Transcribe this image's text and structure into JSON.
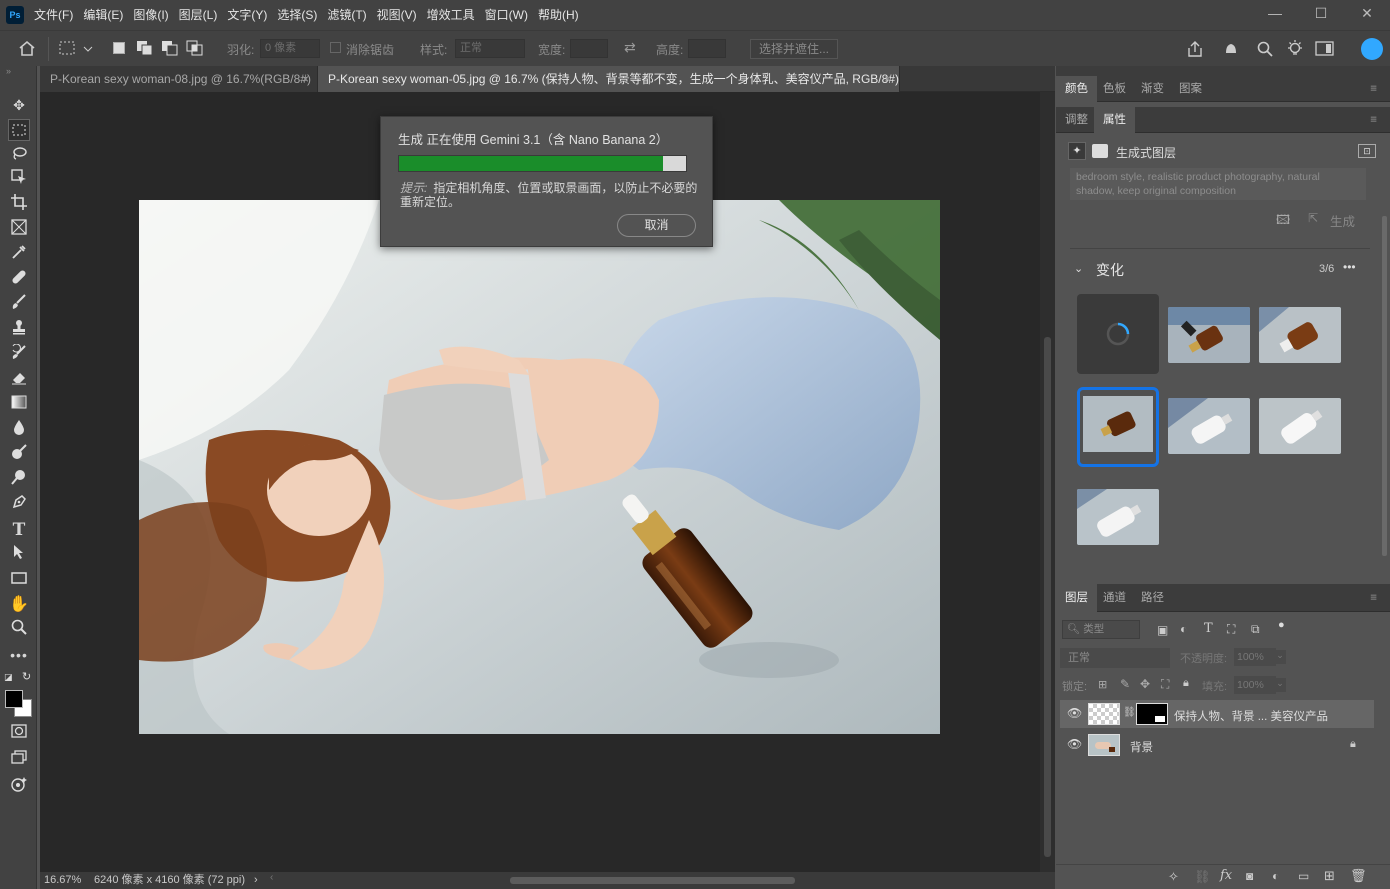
{
  "app": {
    "logo_text": "Ps"
  },
  "menu": [
    "文件(F)",
    "编辑(E)",
    "图像(I)",
    "图层(L)",
    "文字(Y)",
    "选择(S)",
    "滤镜(T)",
    "视图(V)",
    "增效工具",
    "窗口(W)",
    "帮助(H)"
  ],
  "options": {
    "feather_label": "羽化:",
    "feather_value": "0 像素",
    "antialias_label": "消除锯齿",
    "style_label": "样式:",
    "style_value": "正常",
    "width_label": "宽度:",
    "height_label": "高度:",
    "select_mask_button": "选择并遮住..."
  },
  "tabs": [
    {
      "label": "P-Korean sexy woman-08.jpg @ 16.7%(RGB/8#)",
      "close": "×",
      "active": false
    },
    {
      "label": "P-Korean sexy woman-05.jpg @ 16.7% (保持人物、背景等都不变，生成一个身体乳、美容仪产品, RGB/8#) *",
      "close": "×",
      "active": true
    }
  ],
  "dialog": {
    "title": "生成 正在使用 Gemini 3.1（含 Nano Banana 2）",
    "progress": 0.92,
    "tip_label": "提示:",
    "tip_text": "指定相机角度、位置或取景画面，以防止不必要的重新定位。",
    "cancel_label": "取消"
  },
  "status": {
    "zoom": "16.67%",
    "doc_size": "6240 像素 x 4160 像素 (72 ppi)",
    "arrow": "›"
  },
  "panel_top": {
    "tabs": [
      "颜色",
      "色板",
      "渐变",
      "图案"
    ],
    "active": "颜色"
  },
  "panel_props": {
    "tabs": [
      "调整",
      "属性"
    ],
    "active": "属性",
    "layer_type": "生成式图层",
    "prompt_text": "bedroom style, realistic product photography, natural shadow, keep original composition",
    "generate_label": "生成",
    "variations_title": "变化",
    "variations_count": "3/6",
    "more": "•••"
  },
  "panel_layers": {
    "tabs": [
      "图层",
      "通道",
      "路径"
    ],
    "active": "图层",
    "filter_placeholder": "类型",
    "blend_mode": "正常",
    "opacity_label": "不透明度:",
    "opacity_value": "100%",
    "lock_label": "锁定:",
    "fill_label": "填充:",
    "fill_value": "100%",
    "layers": [
      {
        "name": "保持人物、背景 ... 美容仪产品",
        "selected": true
      },
      {
        "name": "背景",
        "selected": false
      }
    ]
  },
  "colors": {
    "accent": "#31a8ff",
    "progress": "#1a8d2a",
    "selection": "#1473e6"
  }
}
